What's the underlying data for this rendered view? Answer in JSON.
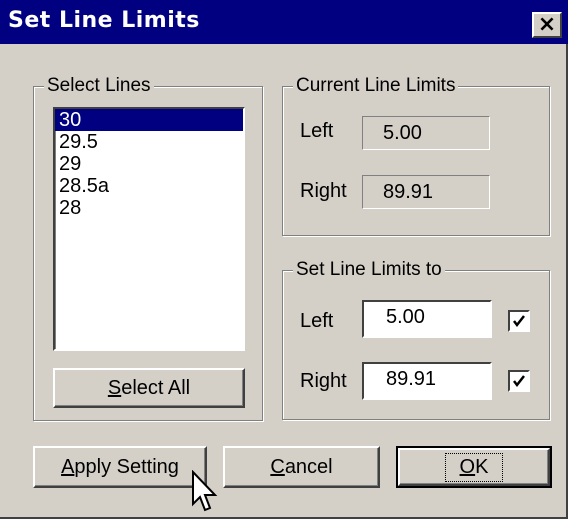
{
  "window": {
    "title": "Set Line Limits",
    "close_glyph": "×"
  },
  "select_lines": {
    "label": "Select Lines",
    "items": [
      "30",
      "29.5",
      "29",
      "28.5a",
      "28"
    ],
    "selected": "30",
    "select_all": {
      "pre": "",
      "mnemonic": "S",
      "post": "elect All"
    }
  },
  "current_limits": {
    "label": "Current Line Limits",
    "left_label": "Left",
    "left_value": "5.00",
    "right_label": "Right",
    "right_value": "89.91"
  },
  "set_limits": {
    "label": "Set Line Limits to",
    "left_label": "Left",
    "left_value": "5.00",
    "left_checked": true,
    "right_label": "Right",
    "right_value": "89.91",
    "right_checked": true
  },
  "buttons": {
    "apply": {
      "mnemonic": "A",
      "post": "pply Setting"
    },
    "cancel": {
      "mnemonic": "C",
      "post": "ancel"
    },
    "ok": {
      "mnemonic": "O",
      "post": "K"
    }
  }
}
